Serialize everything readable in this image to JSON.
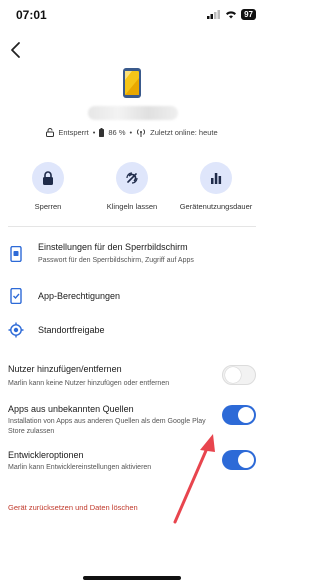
{
  "status": {
    "time": "07:01",
    "battery": "97"
  },
  "device": {
    "status": {
      "lock": "Entsperrt",
      "battery": "86 %",
      "online": "Zuletzt online: heute"
    }
  },
  "actions": [
    {
      "label": "Sperren",
      "icon": "lock-icon"
    },
    {
      "label": "Klingeln lassen",
      "icon": "ring-icon"
    },
    {
      "label": "Gerätenutzungsdauer",
      "icon": "bar-chart-icon"
    }
  ],
  "menu": [
    {
      "title": "Einstellungen für den Sperrbildschirm",
      "sub": "Passwort für den Sperrbildschirm, Zugriff auf Apps",
      "icon": "phone-lock-icon"
    },
    {
      "title": "App-Berechtigungen",
      "sub": "",
      "icon": "phone-check-icon"
    },
    {
      "title": "Standortfreigabe",
      "sub": "",
      "icon": "location-icon"
    }
  ],
  "toggles": [
    {
      "title": "Nutzer hinzufügen/entfernen",
      "sub": "Marlin kann keine Nutzer hinzufügen oder entfernen",
      "state": "off"
    },
    {
      "title": "Apps aus unbekannten Quellen",
      "sub": "Installation von Apps aus anderen Quellen als dem Google Play Store zulassen",
      "state": "on"
    },
    {
      "title": "Entwickleroptionen",
      "sub": "Marlin kann Entwicklereinstellungen aktivieren",
      "state": "on"
    }
  ],
  "reset_label": "Gerät zurücksetzen und Daten löschen",
  "colors": {
    "accent": "#2d6ad7",
    "action_bg": "#dfe6fb",
    "danger": "#c0392b",
    "annotation_arrow": "#e8454e"
  }
}
